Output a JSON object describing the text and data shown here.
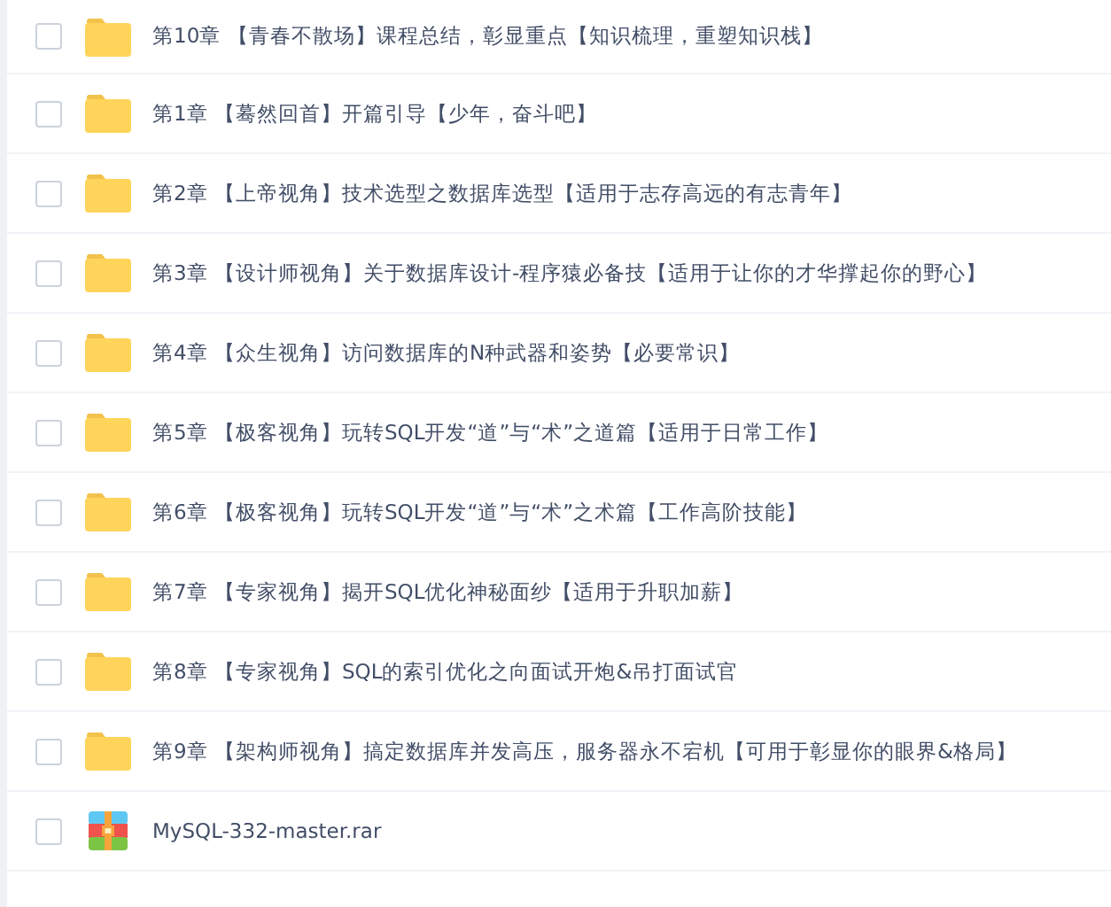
{
  "files": [
    {
      "kind": "folder",
      "name": "第10章 【青春不散场】课程总结，彰显重点【知识梳理，重塑知识栈】",
      "checked": false
    },
    {
      "kind": "folder",
      "name": "第1章 【蓦然回首】开篇引导【少年，奋斗吧】",
      "checked": false
    },
    {
      "kind": "folder",
      "name": "第2章 【上帝视角】技术选型之数据库选型【适用于志存高远的有志青年】",
      "checked": false
    },
    {
      "kind": "folder",
      "name": "第3章 【设计师视角】关于数据库设计-程序猿必备技【适用于让你的才华撑起你的野心】",
      "checked": false
    },
    {
      "kind": "folder",
      "name": "第4章 【众生视角】访问数据库的N种武器和姿势【必要常识】",
      "checked": false
    },
    {
      "kind": "folder",
      "name": "第5章 【极客视角】玩转SQL开发“道”与“术”之道篇【适用于日常工作】",
      "checked": false
    },
    {
      "kind": "folder",
      "name": "第6章 【极客视角】玩转SQL开发“道”与“术”之术篇【工作高阶技能】",
      "checked": false
    },
    {
      "kind": "folder",
      "name": "第7章 【专家视角】揭开SQL优化神秘面纱【适用于升职加薪】",
      "checked": false
    },
    {
      "kind": "folder",
      "name": "第8章 【专家视角】SQL的索引优化之向面试开炮&吊打面试官",
      "checked": false
    },
    {
      "kind": "folder",
      "name": "第9章 【架构师视角】搞定数据库并发高压，服务器永不宕机【可用于彰显你的眼界&格局】",
      "checked": false
    },
    {
      "kind": "archive",
      "name": "MySQL-332-master.rar",
      "checked": false
    }
  ]
}
